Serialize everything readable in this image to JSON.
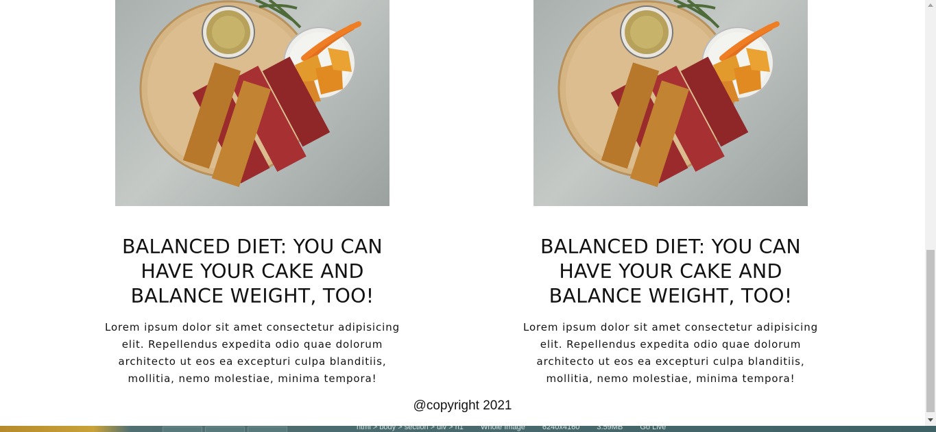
{
  "cards": [
    {
      "image_alt": "Wooden board with hummus, crackers, carrots and chips",
      "title": "BALANCED DIET: YOU CAN HAVE YOUR CAKE AND BALANCE WEIGHT, TOO!",
      "text": "Lorem ipsum dolor sit amet consectetur adipisicing elit. Repellendus expedita odio quae dolorum architecto ut eos ea excepturi culpa blanditiis, mollitia, nemo molestiae, minima tempora!"
    },
    {
      "image_alt": "Wooden board with hummus, crackers, carrots and chips",
      "title": "BALANCED DIET: YOU CAN HAVE YOUR CAKE AND BALANCE WEIGHT, TOO!",
      "text": "Lorem ipsum dolor sit amet consectetur adipisicing elit. Repellendus expedita odio quae dolorum architecto ut eos ea excepturi culpa blanditiis, mollitia, nemo molestiae, minima tempora!"
    }
  ],
  "footer": {
    "copyright": "@copyright 2021"
  },
  "statusbar": {
    "breadcrumb": "html > body > section > div > h1",
    "image_label": "Whole Image",
    "dimensions": "6240x4160",
    "size": "3.59MB",
    "go_live": "Go Live"
  },
  "colors": {
    "page_bg": "#ffffff",
    "text": "#111111",
    "board": "#d9b98a",
    "taskbar": "#3f6266"
  }
}
